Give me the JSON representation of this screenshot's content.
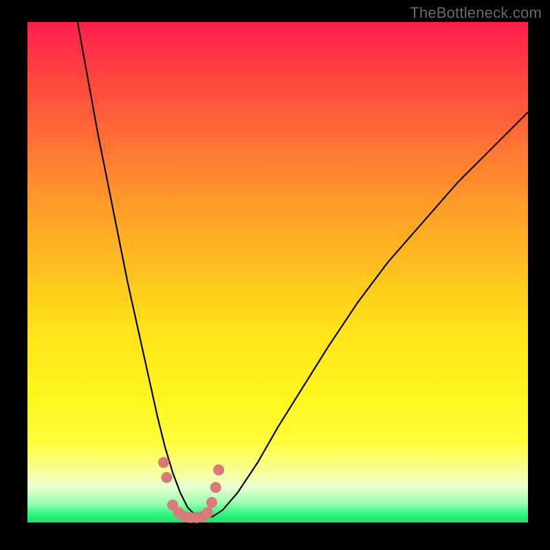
{
  "watermark": "TheBottleneck.com",
  "colors": {
    "frame": "#000000",
    "curve": "#000000",
    "dot_fill": "#d97a7a",
    "gradient_top": "#ff1f4e",
    "gradient_bottom": "#16e46e"
  },
  "chart_data": {
    "type": "line",
    "title": "",
    "xlabel": "",
    "ylabel": "",
    "xlim": [
      0,
      100
    ],
    "ylim": [
      0,
      100
    ],
    "grid": false,
    "series": [
      {
        "name": "bottleneck-curve",
        "x": [
          10,
          12,
          14,
          16,
          18,
          20,
          22,
          24,
          26,
          27.5,
          29,
          30.5,
          32,
          33.5,
          35,
          37,
          39,
          42,
          46,
          50,
          55,
          60,
          66,
          72,
          79,
          86,
          94,
          100
        ],
        "y": [
          100,
          89,
          78,
          68,
          58,
          48,
          39,
          30,
          21,
          15,
          10,
          6,
          3,
          1.5,
          1,
          1.2,
          2.5,
          6,
          12,
          19,
          27,
          35,
          44,
          52,
          60,
          68,
          76,
          82
        ]
      }
    ],
    "dots": {
      "name": "highlight-dots",
      "x": [
        27.2,
        27.8,
        29.0,
        30.2,
        31.4,
        32.6,
        33.8,
        35.0,
        36.0,
        36.8,
        37.6,
        38.2
      ],
      "y": [
        12.0,
        9.0,
        3.5,
        2.0,
        1.2,
        1.0,
        1.0,
        1.2,
        2.0,
        4.0,
        7.0,
        10.5
      ],
      "r": 8
    }
  }
}
